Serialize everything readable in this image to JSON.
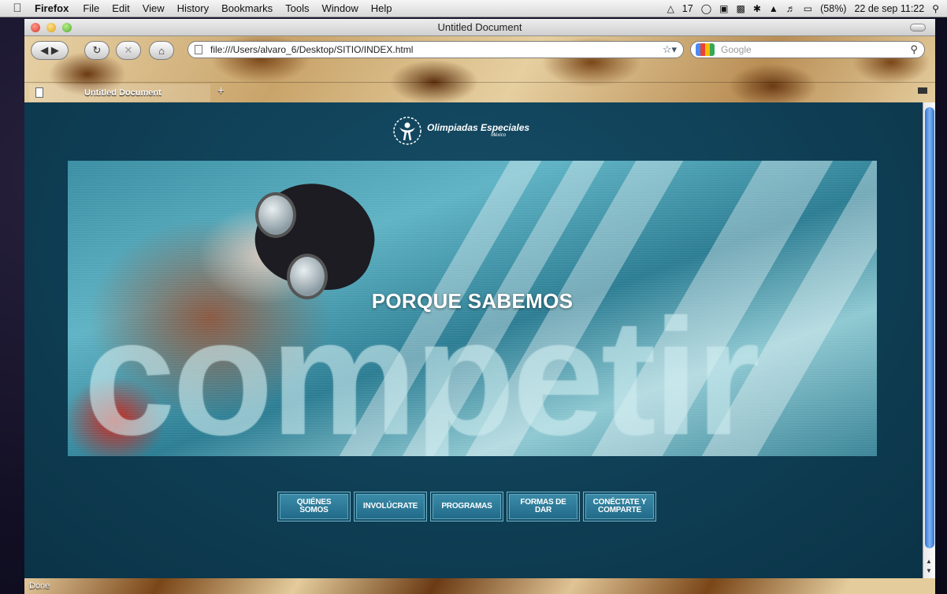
{
  "menubar": {
    "app_name": "Firefox",
    "items": [
      "File",
      "Edit",
      "View",
      "History",
      "Bookmarks",
      "Tools",
      "Window",
      "Help"
    ],
    "status_count": "17",
    "battery": "(58%)",
    "datetime": "22 de sep 11:22"
  },
  "window": {
    "title": "Untitled Document"
  },
  "toolbar": {
    "url": "file:///Users/alvaro_6/Desktop/SITIO/INDEX.html",
    "search_placeholder": "Google"
  },
  "tabs": [
    {
      "label": "Untitled Document"
    }
  ],
  "page": {
    "logo_title": "Olimpiadas Especiales",
    "logo_sub": "México",
    "hero_subtitle": "PORQUE SABEMOS",
    "hero_word": "competir",
    "nav": [
      {
        "label": "QUIÉNES SOMOS"
      },
      {
        "label": "INVOLÚCRATE"
      },
      {
        "label": "PROGRAMAS"
      },
      {
        "label": "FORMAS DE DAR"
      },
      {
        "label": "CONÉCTATE Y COMPARTE"
      }
    ]
  },
  "statusbar": {
    "text": "Done"
  },
  "colors": {
    "page_bg": "#0f3f55",
    "nav_button": "#2a7896"
  }
}
